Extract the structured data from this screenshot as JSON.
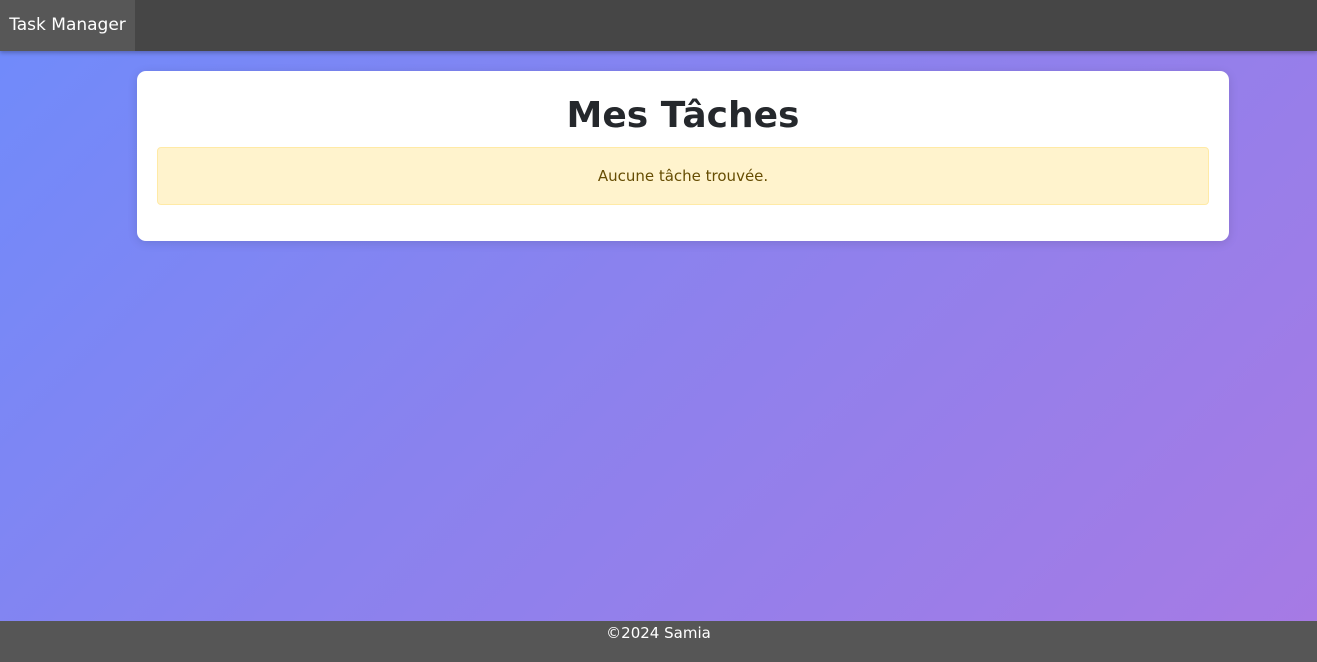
{
  "navbar": {
    "brand": "Task Manager"
  },
  "main": {
    "title": "Mes Tâches",
    "empty_message": "Aucune tâche trouvée."
  },
  "footer": {
    "text": "©2024 Samia"
  },
  "colors": {
    "navbar_bg": "#464646",
    "brand_bg": "#575757",
    "background_gradient_start": "#6f8bfb",
    "background_gradient_end": "#a77ae4",
    "alert_bg": "#fff3cd",
    "footer_bg": "#565656"
  }
}
